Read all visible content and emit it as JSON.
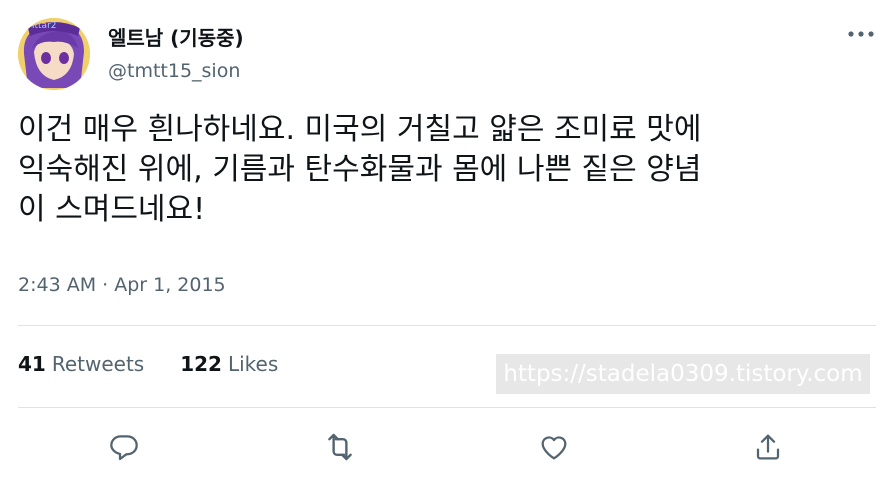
{
  "user": {
    "display_name": "엘트남 (기동중)",
    "handle": "@tmtt15_sion",
    "avatar_text": "ittar2"
  },
  "tweet": {
    "text": "이건 매우 흰나하네요. 미국의 거칠고 얇은 조미료 맛에\n익숙해진 위에, 기름과 탄수화물과 몸에 나쁜 짙은 양념\n이 스며드네요!",
    "timestamp": "2:43 AM · Apr 1, 2015"
  },
  "stats": {
    "retweets_count": "41",
    "retweets_label": "Retweets",
    "likes_count": "122",
    "likes_label": "Likes"
  },
  "watermark": "https://stadela0309.tistory.com",
  "icons": {
    "more": "more-horizontal-icon",
    "reply": "reply-icon",
    "retweet": "retweet-icon",
    "like": "like-icon",
    "share": "share-icon"
  },
  "colors": {
    "text": "#0f1419",
    "secondary": "#536471",
    "icon": "#536471",
    "divider": "#dfe3e6"
  }
}
